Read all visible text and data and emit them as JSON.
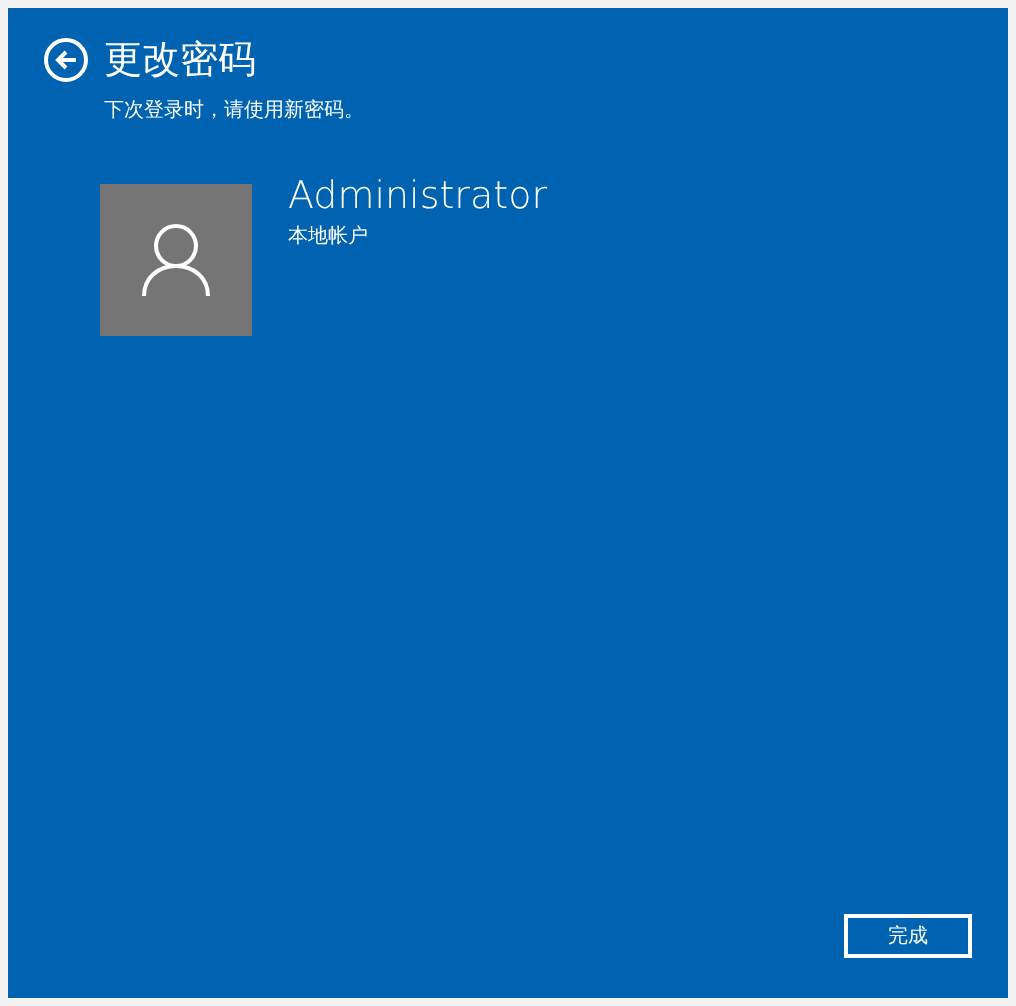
{
  "header": {
    "title": "更改密码",
    "subtitle": "下次登录时，请使用新密码。"
  },
  "account": {
    "name": "Administrator",
    "type": "本地帐户"
  },
  "buttons": [
    "完成"
  ]
}
